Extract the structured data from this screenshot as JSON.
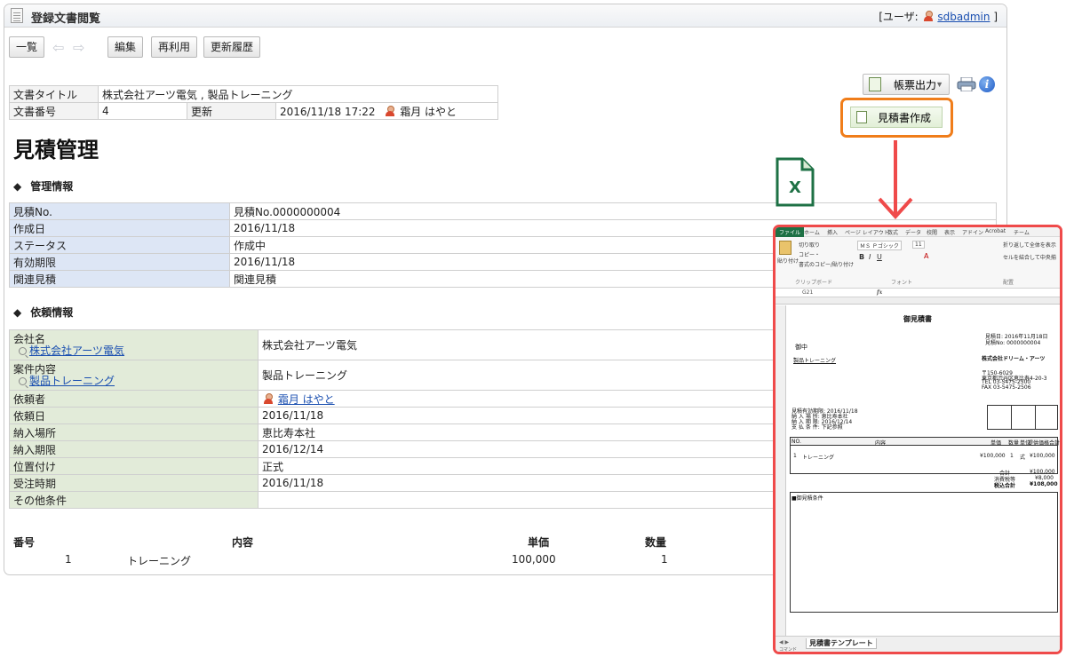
{
  "window": {
    "title": "登録文書閲覧",
    "user_prefix": "[ユーザ:",
    "user_name": "sdbadmin",
    "user_suffix": "]"
  },
  "toolbar": {
    "list_label": "一覧",
    "edit_label": "編集",
    "reuse_label": "再利用",
    "history_label": "更新履歴"
  },
  "doc_info": {
    "title_label": "文書タイトル",
    "title_value": "株式会社アーツ電気 , 製品トレーニング",
    "number_label": "文書番号",
    "number_value": "4",
    "updated_label": "更新",
    "updated_value": "2016/11/18 17:22",
    "updated_by": "霜月 はやと"
  },
  "actions": {
    "report_label": "帳票出力",
    "estimate_label": "見積書作成"
  },
  "page_heading": "見積管理",
  "management": {
    "heading": "管理情報",
    "rows": [
      {
        "label": "見積No.",
        "value": "見積No.0000000004"
      },
      {
        "label": "作成日",
        "value": "2016/11/18"
      },
      {
        "label": "ステータス",
        "value": "作成中"
      },
      {
        "label": "有効期限",
        "value": "2016/11/18"
      },
      {
        "label": "関連見積",
        "value": "関連見積"
      }
    ]
  },
  "request": {
    "heading": "依頼情報",
    "company_label": "会社名",
    "company_link": "株式会社アーツ電気",
    "company_value": "株式会社アーツ電気",
    "case_label": "案件内容",
    "case_link": "製品トレーニング",
    "case_value": "製品トレーニング",
    "requester_label": "依頼者",
    "requester_value": "霜月 はやと",
    "rows": [
      {
        "label": "依頼日",
        "value": "2016/11/18"
      },
      {
        "label": "納入場所",
        "value": "恵比寿本社"
      },
      {
        "label": "納入期限",
        "value": "2016/12/14"
      },
      {
        "label": "位置付け",
        "value": "正式"
      },
      {
        "label": "受注時期",
        "value": "2016/11/18"
      },
      {
        "label": "その他条件",
        "value": ""
      }
    ]
  },
  "items": {
    "headers": {
      "number": "番号",
      "content": "内容",
      "unit_price": "単価",
      "quantity": "数量"
    },
    "row": {
      "number": "1",
      "content": "トレーニング",
      "unit_price": "100,000",
      "quantity": "1"
    }
  },
  "excel": {
    "tabs": [
      "ファイル",
      "ホーム",
      "挿入",
      "ページ レイアウト",
      "数式",
      "データ",
      "校閲",
      "表示",
      "アドイン",
      "Acrobat",
      "チーム"
    ],
    "ribbon": {
      "cut": "切り取り",
      "copy": "コピー・",
      "format_copy": "書式のコピー/貼り付け",
      "paste": "貼り付け",
      "font_name": "ＭＳ Ｐゴシック",
      "font_size": "11",
      "wrap": "折り返して全体を表示",
      "merge": "セルを結合して中央揃",
      "clipboard": "クリップボード",
      "font": "フォント",
      "align": "配置"
    },
    "cell_ref": "G21",
    "doc": {
      "title": "御見積書",
      "date": "見積日: 2016年11月18日",
      "number": "見積No: 0000000004",
      "recipient": "御中",
      "subject": "製品トレーニング",
      "company": "株式会社ドリーム・アーツ",
      "zip": "〒150-6029",
      "addr": "東京都渋谷区恵比寿4-20-3",
      "tel": "TEL 03-5475-2500",
      "fax": "FAX 03-5475-2506",
      "cond1": "見積有効期限:  2016/11/18",
      "cond2": "納 入 場 所:  恵比寿本社",
      "cond3": "納 入 期 限:  2016/12/14",
      "cond4": "支 払 条 件:  下記参照",
      "col_no": "NO.",
      "col_content": "内容",
      "col_price": "単価",
      "col_qty": "数量",
      "col_unit": "単位",
      "col_amount": "提供価格合計",
      "line_no": "1",
      "line_content": "トレーニング",
      "line_price": "¥100,000",
      "line_qty": "1",
      "line_unit": "式",
      "line_amount": "¥100,000",
      "subtotal_label": "合計",
      "subtotal": "¥100,000",
      "tax_label": "消費税等",
      "tax": "¥8,000",
      "total_label": "税込合計",
      "total": "¥108,000",
      "notes": "■御見積条件"
    },
    "sheet_tab": "見積書テンプレート",
    "status": "コマンド"
  }
}
